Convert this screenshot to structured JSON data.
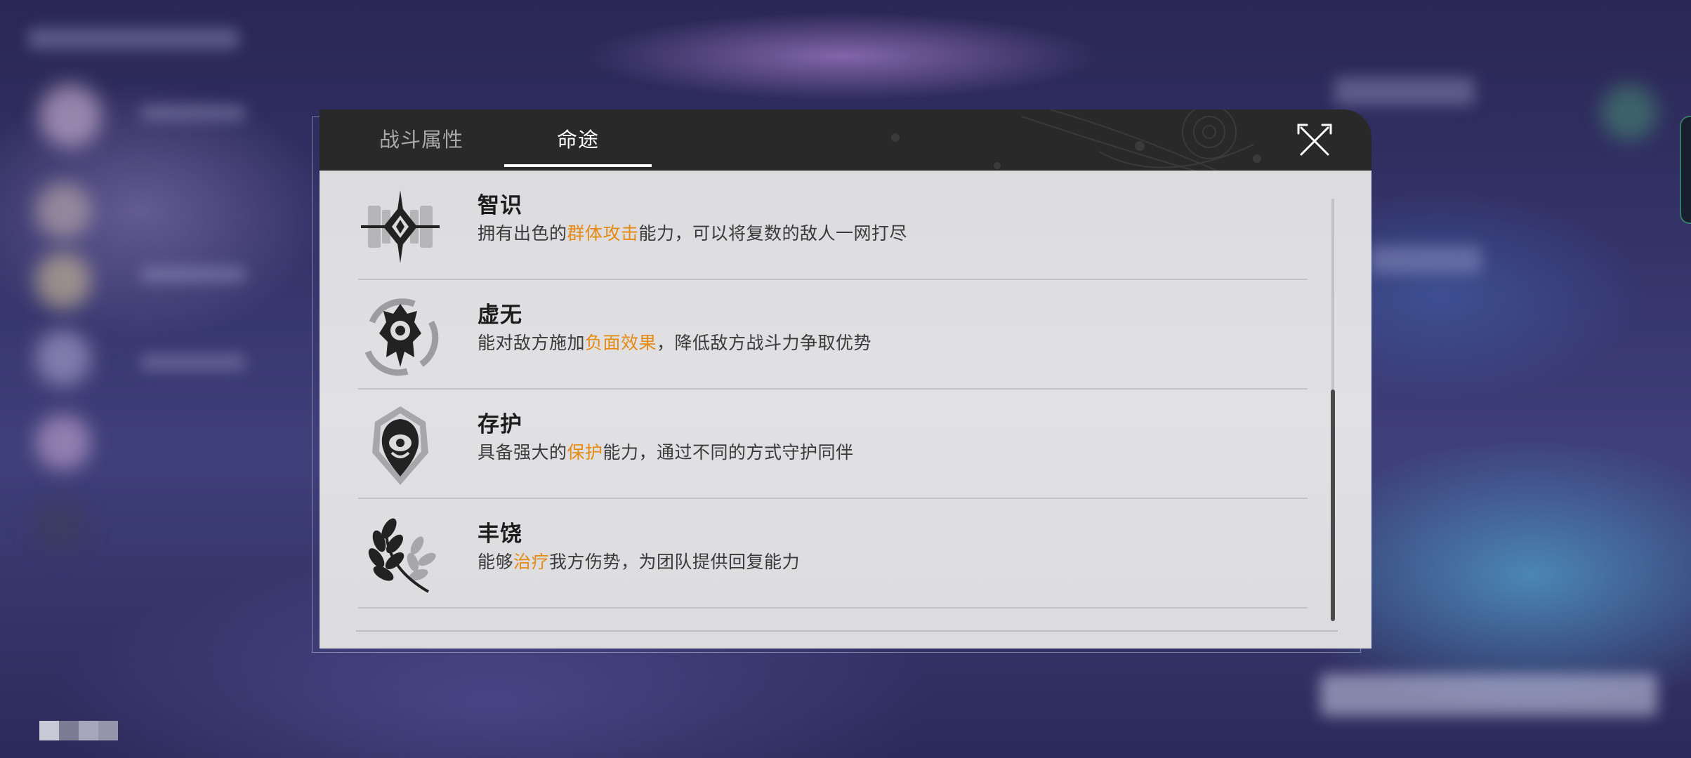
{
  "tabs": [
    {
      "label": "战斗属性",
      "active": false
    },
    {
      "label": "命途",
      "active": true
    }
  ],
  "paths": [
    {
      "name": "智识",
      "desc_pre": "拥有出色的",
      "desc_hl": "群体攻击",
      "desc_post": "能力，可以将复数的敌人一网打尽",
      "icon": "erudition-icon"
    },
    {
      "name": "虚无",
      "desc_pre": "能对敌方施加",
      "desc_hl": "负面效果",
      "desc_post": "，降低敌方战斗力争取优势",
      "icon": "nihility-icon"
    },
    {
      "name": "存护",
      "desc_pre": "具备强大的",
      "desc_hl": "保护",
      "desc_post": "能力，通过不同的方式守护同伴",
      "icon": "preservation-icon"
    },
    {
      "name": "丰饶",
      "desc_pre": "能够",
      "desc_hl": "治疗",
      "desc_post": "我方伤势，为团队提供回复能力",
      "icon": "abundance-icon"
    }
  ],
  "scroll_fraction_shown": 0.55,
  "colors": {
    "header_bg": "#292929",
    "panel_bg": "#dedee1",
    "highlight": "#e58b14",
    "active_tab": "#ffffff",
    "inactive_tab": "#a9a9a9"
  }
}
